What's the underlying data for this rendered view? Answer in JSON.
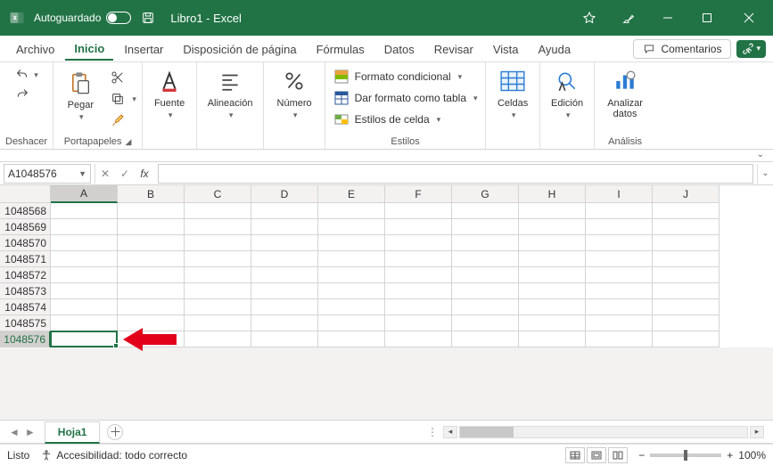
{
  "titlebar": {
    "autosave_label": "Autoguardado",
    "file_title": "Libro1  -  Excel"
  },
  "menu": {
    "tabs": [
      "Archivo",
      "Inicio",
      "Insertar",
      "Disposición de página",
      "Fórmulas",
      "Datos",
      "Revisar",
      "Vista",
      "Ayuda"
    ],
    "active_index": 1,
    "comments_label": "Comentarios"
  },
  "ribbon": {
    "undo_group_label": "Deshacer",
    "clipboard": {
      "paste_label": "Pegar",
      "group_label": "Portapapeles"
    },
    "font": {
      "label": "Fuente"
    },
    "alignment": {
      "label": "Alineación"
    },
    "number": {
      "label": "Número"
    },
    "styles": {
      "group_label": "Estilos",
      "conditional_label": "Formato condicional",
      "as_table_label": "Dar formato como tabla",
      "cell_styles_label": "Estilos de celda"
    },
    "cells": {
      "label": "Celdas"
    },
    "editing": {
      "label": "Edición"
    },
    "analyze": {
      "label": "Analizar datos",
      "group_label": "Análisis"
    }
  },
  "formula_bar": {
    "name_box": "A1048576",
    "fx_label": "fx",
    "formula_value": ""
  },
  "grid": {
    "columns": [
      "A",
      "B",
      "C",
      "D",
      "E",
      "F",
      "G",
      "H",
      "I",
      "J"
    ],
    "selected_col_index": 0,
    "rows": [
      1048568,
      1048569,
      1048570,
      1048571,
      1048572,
      1048573,
      1048574,
      1048575,
      1048576
    ],
    "selected_row_index": 8,
    "selected_cell": "A1048576"
  },
  "sheet": {
    "active_tab": "Hoja1"
  },
  "statusbar": {
    "state": "Listo",
    "accessibility": "Accesibilidad: todo correcto",
    "zoom": "100%"
  }
}
